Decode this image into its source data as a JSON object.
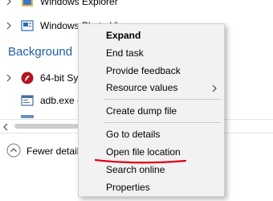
{
  "processes": {
    "row_windows_explorer": "Windows Explorer",
    "row_windows_photo_viewer": "Windows Photo Viewer"
  },
  "section": {
    "background_heading": "Background"
  },
  "background_rows": [
    {
      "label": "64-bit Sy"
    },
    {
      "label": "adb.exe ("
    }
  ],
  "footer": {
    "fewer_details_label": "Fewer detail"
  },
  "context_menu": {
    "items": [
      {
        "label": "Expand",
        "bold": true
      },
      {
        "label": "End task"
      },
      {
        "label": "Provide feedback"
      },
      {
        "label": "Resource values",
        "has_submenu": true
      },
      {
        "label": "Create dump file"
      },
      {
        "label": "Go to details"
      },
      {
        "label": "Open file location"
      },
      {
        "label": "Search online"
      },
      {
        "label": "Properties"
      }
    ]
  },
  "colors": {
    "section_heading": "#1c5fa8",
    "annotation_underline": "#e0001a",
    "menu_background": "#f2f2f2"
  },
  "icons": {
    "windows_explorer": "folder-icon",
    "windows_photo_viewer": "photo-viewer-icon",
    "background_row_1": "red-app-icon",
    "background_row_2": "console-icon",
    "submenu": "chevron-right-icon",
    "fewer_details": "chevron-up-circle-icon"
  }
}
